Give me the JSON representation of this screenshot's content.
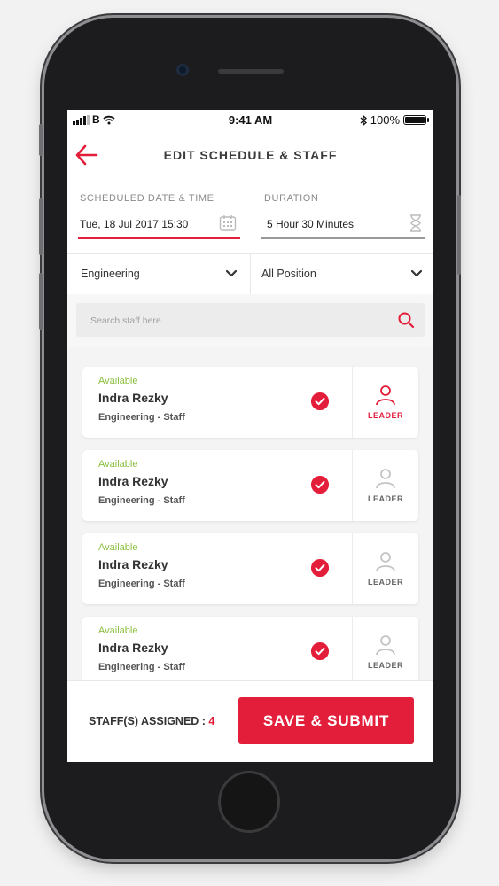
{
  "status_bar": {
    "carrier": "B",
    "time": "9:41 AM",
    "battery": "100%"
  },
  "header": {
    "title": "EDIT SCHEDULE & STAFF",
    "back_icon": "arrow-left-icon"
  },
  "form": {
    "date_label": "SCHEDULED DATE & TIME",
    "date_value": "Tue, 18 Jul 2017 15:30",
    "duration_label": "DURATION",
    "duration_value": "5 Hour 30 Minutes"
  },
  "filters": {
    "department": "Engineering",
    "position": "All Position"
  },
  "search": {
    "placeholder": "Search staff here"
  },
  "staff": [
    {
      "status": "Available",
      "name": "Indra Rezky",
      "dept": "Engineering - Staff",
      "leader_label": "LEADER",
      "is_leader": true
    },
    {
      "status": "Available",
      "name": "Indra Rezky",
      "dept": "Engineering - Staff",
      "leader_label": "LEADER",
      "is_leader": false
    },
    {
      "status": "Available",
      "name": "Indra Rezky",
      "dept": "Engineering - Staff",
      "leader_label": "LEADER",
      "is_leader": false
    },
    {
      "status": "Available",
      "name": "Indra Rezky",
      "dept": "Engineering - Staff",
      "leader_label": "LEADER",
      "is_leader": false
    }
  ],
  "footer": {
    "assigned_label": "STAFF(S) ASSIGNED : ",
    "assigned_count": "4",
    "submit_label": "SAVE & SUBMIT"
  },
  "colors": {
    "accent": "#e31e3a",
    "available": "#8bbf3f",
    "text": "#333333"
  }
}
